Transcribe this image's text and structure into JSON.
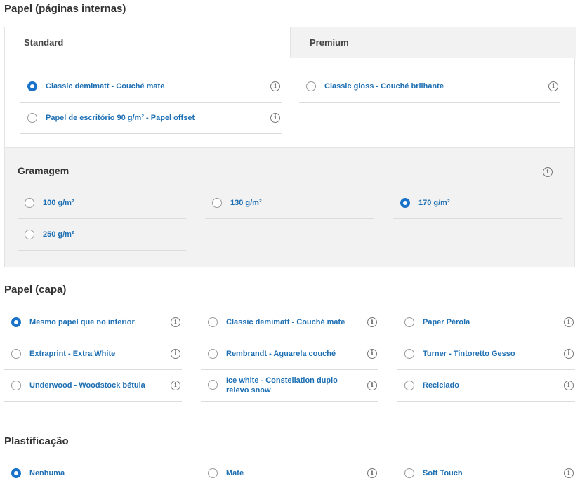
{
  "interior": {
    "title": "Papel (páginas internas)",
    "tabs": [
      {
        "label": "Standard",
        "active": true
      },
      {
        "label": "Premium",
        "active": false
      }
    ],
    "standard_options": [
      {
        "label": "Classic demimatt - Couché mate",
        "selected": true
      },
      {
        "label": "Papel de escritório 90 g/m² - Papel offset",
        "selected": false
      }
    ],
    "premium_options": [
      {
        "label": "Classic gloss - Couché brilhante",
        "selected": false
      }
    ],
    "gramagem": {
      "title": "Gramagem",
      "options": [
        {
          "label": "100 g/m²",
          "selected": false
        },
        {
          "label": "130 g/m²",
          "selected": false
        },
        {
          "label": "170 g/m²",
          "selected": true
        },
        {
          "label": "250 g/m²",
          "selected": false
        }
      ]
    }
  },
  "cover": {
    "title": "Papel (capa)",
    "options": [
      {
        "label": "Mesmo papel que no interior",
        "selected": true
      },
      {
        "label": "Classic demimatt - Couché mate",
        "selected": false
      },
      {
        "label": "Paper Pérola",
        "selected": false
      },
      {
        "label": "Extraprint - Extra White",
        "selected": false
      },
      {
        "label": "Rembrandt - Aguarela couché",
        "selected": false
      },
      {
        "label": "Turner - Tintoretto Gesso",
        "selected": false
      },
      {
        "label": "Underwood - Woodstock bétula",
        "selected": false
      },
      {
        "label": "Ice white - Constellation duplo relevo snow",
        "selected": false
      },
      {
        "label": "Reciclado",
        "selected": false
      }
    ]
  },
  "lamination": {
    "title": "Plastificação",
    "options": [
      {
        "label": "Nenhuma",
        "selected": true
      },
      {
        "label": "Mate",
        "selected": false
      },
      {
        "label": "Soft Touch",
        "selected": false
      }
    ]
  },
  "icons": {
    "info": "info-icon",
    "info_glyph": "i"
  },
  "colors": {
    "accent": "#1a73c8",
    "label": "#1d6fb3",
    "panel": "#f2f2f2"
  }
}
